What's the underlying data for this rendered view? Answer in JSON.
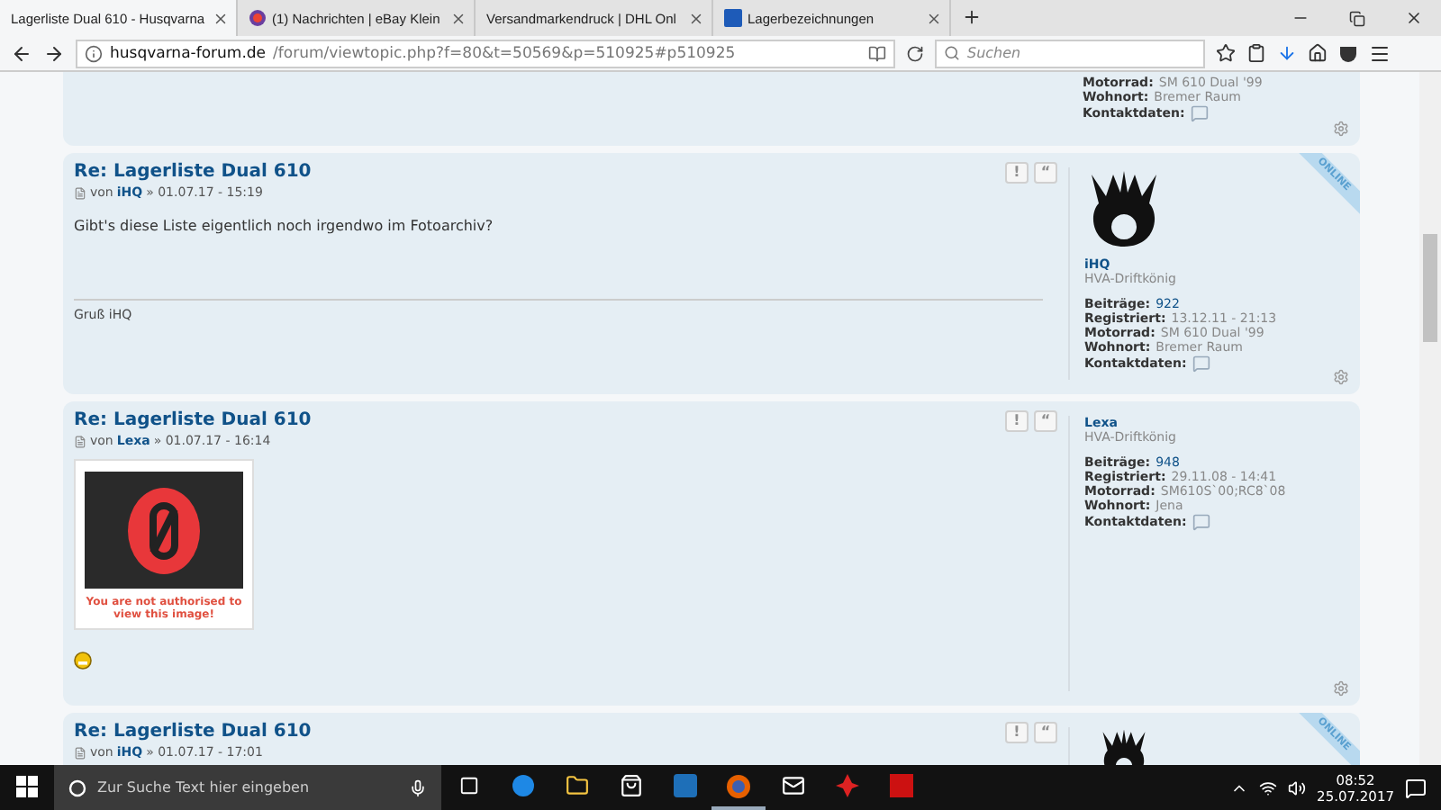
{
  "browser": {
    "tabs": [
      {
        "title": "Lagerliste Dual 610 - Husqvarna",
        "selected": true
      },
      {
        "title": "(1) Nachrichten | eBay Klein",
        "selected": false
      },
      {
        "title": "Versandmarkendruck | DHL Onl",
        "selected": false
      },
      {
        "title": "Lagerbezeichnungen",
        "selected": false
      }
    ],
    "url_host": "husqvarna-forum.de",
    "url_path": "/forum/viewtopic.php?f=80&t=50569&p=510925#p510925",
    "search_placeholder": "Suchen"
  },
  "previous_post": {
    "fields": [
      {
        "label": "Motorrad:",
        "value": "SM 610 Dual '99"
      },
      {
        "label": "Wohnort:",
        "value": "Bremer Raum"
      }
    ],
    "contact_label": "Kontaktdaten:"
  },
  "posts": [
    {
      "title": "Re: Lagerliste Dual 610",
      "by": "von",
      "author": "iHQ",
      "date": "» 01.07.17 - 15:19",
      "report_button": "!",
      "quote_button": "“",
      "online": true,
      "online_label": "ONLINE",
      "content": [
        {
          "kind": "text",
          "text": "Gibt's diese Liste eigentlich noch irgendwo im Fotoarchiv?"
        }
      ],
      "signature": "Gruß iHQ",
      "profile": {
        "avatar": true,
        "name": "iHQ",
        "rank": "HVA-Driftkönig",
        "fields": [
          {
            "label": "Beiträge:",
            "value": "922"
          },
          {
            "label": "Registriert:",
            "value": "13.12.11 - 21:13"
          },
          {
            "label": "Motorrad:",
            "value": "SM 610 Dual '99"
          },
          {
            "label": "Wohnort:",
            "value": "Bremer Raum"
          }
        ],
        "contact_label": "Kontaktdaten:"
      }
    },
    {
      "title": "Re: Lagerliste Dual 610",
      "by": "von",
      "author": "Lexa",
      "date": "» 01.07.17 - 16:14",
      "report_button": "!",
      "quote_button": "“",
      "online": false,
      "content": [
        {
          "kind": "image",
          "text": "You are not authorised to view this image!"
        },
        {
          "kind": "smiley"
        }
      ],
      "profile": {
        "avatar": false,
        "name": "Lexa",
        "rank": "HVA-Driftkönig",
        "fields": [
          {
            "label": "Beiträge:",
            "value": "948"
          },
          {
            "label": "Registriert:",
            "value": "29.11.08 - 14:41"
          },
          {
            "label": "Motorrad:",
            "value": "SM610S`00;RC8`08"
          },
          {
            "label": "Wohnort:",
            "value": "Jena"
          }
        ],
        "contact_label": "Kontaktdaten:"
      }
    },
    {
      "title": "Re: Lagerliste Dual 610",
      "by": "von",
      "author": "iHQ",
      "date": "» 01.07.17 - 17:01",
      "report_button": "!",
      "quote_button": "“",
      "online": true,
      "online_label": "ONLINE",
      "profile": {
        "avatar": true
      }
    }
  ],
  "taskbar": {
    "search_placeholder": "Zur Suche Text hier eingeben",
    "time": "08:52",
    "date": "25.07.2017"
  }
}
